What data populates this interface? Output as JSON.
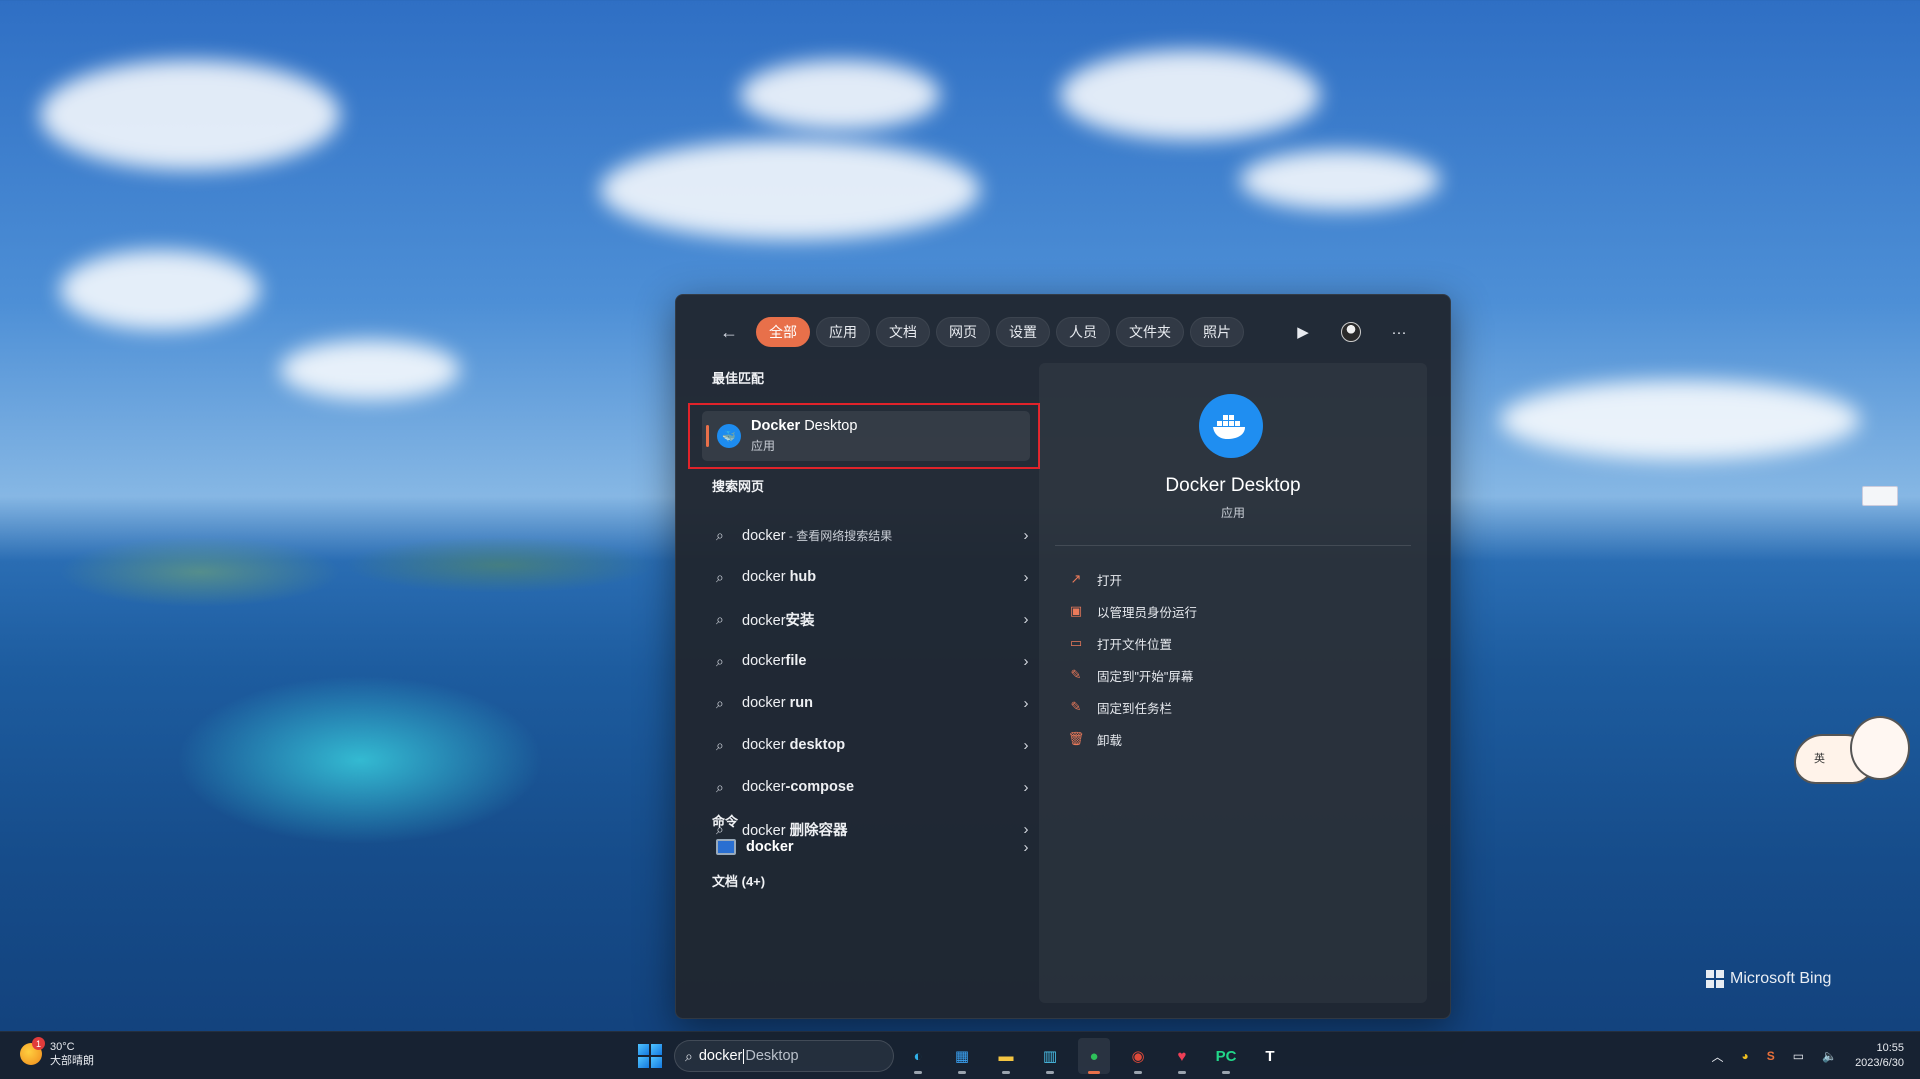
{
  "start_menu": {
    "filters": [
      "全部",
      "应用",
      "文档",
      "网页",
      "设置",
      "人员",
      "文件夹",
      "照片"
    ],
    "active_filter": "全部",
    "best_match_heading": "最佳匹配",
    "best_match": {
      "name_bold": "Docker",
      "name_rest": " Desktop",
      "type": "应用"
    },
    "web_search_heading": "搜索网页",
    "web_results": [
      {
        "pre": "docker",
        "bold": "",
        "hint": " - 查看网络搜索结果"
      },
      {
        "pre": "docker ",
        "bold": "hub",
        "hint": ""
      },
      {
        "pre": "docker",
        "bold": "安装",
        "hint": ""
      },
      {
        "pre": "docker",
        "bold": "file",
        "hint": ""
      },
      {
        "pre": "docker ",
        "bold": "run",
        "hint": ""
      },
      {
        "pre": "docker ",
        "bold": "desktop",
        "hint": ""
      },
      {
        "pre": "docker",
        "bold": "-compose",
        "hint": ""
      },
      {
        "pre": "docker ",
        "bold": "删除容器",
        "hint": ""
      }
    ],
    "commands_heading": "命令",
    "command": "docker",
    "documents_heading": "文档 (4+)",
    "preview": {
      "title": "Docker Desktop",
      "subtitle": "应用",
      "actions": [
        {
          "icon": "open-external-icon",
          "glyph": "↗",
          "label": "打开"
        },
        {
          "icon": "admin-shield-icon",
          "glyph": "▣",
          "label": "以管理员身份运行"
        },
        {
          "icon": "folder-icon",
          "glyph": "▭",
          "label": "打开文件位置"
        },
        {
          "icon": "pin-icon",
          "glyph": "✎",
          "label": "固定到\"开始\"屏幕"
        },
        {
          "icon": "pin-icon",
          "glyph": "✎",
          "label": "固定到任务栏"
        },
        {
          "icon": "trash-icon",
          "glyph": "🗑",
          "label": "卸载"
        }
      ]
    }
  },
  "taskbar": {
    "weather": {
      "temp": "30°C",
      "condition": "大部晴朗",
      "badge": "1"
    },
    "search": {
      "typed": "docker",
      "suggestion": "Desktop"
    },
    "apps": [
      {
        "name": "edge",
        "glyph": "◐",
        "color": "#2fb0e8",
        "active": false
      },
      {
        "name": "store",
        "glyph": "▦",
        "color": "#3aa0f0",
        "active": false
      },
      {
        "name": "file-explorer",
        "glyph": "▬",
        "color": "#f4c542",
        "active": false
      },
      {
        "name": "buildings",
        "glyph": "▥",
        "color": "#4ac0e8",
        "active": false
      },
      {
        "name": "wechat",
        "glyph": "●",
        "color": "#2ec15a",
        "active": true
      },
      {
        "name": "swirl",
        "glyph": "◉",
        "color": "#e04a3a",
        "active": false
      },
      {
        "name": "pocket",
        "glyph": "♥",
        "color": "#ef3f56",
        "active": false
      },
      {
        "name": "pycharm",
        "glyph": "PC",
        "color": "#21d789",
        "active": false
      },
      {
        "name": "typora",
        "glyph": "T",
        "color": "#ffffff",
        "active": false
      }
    ],
    "clock": {
      "time": "10:55",
      "date": "2023/6/30"
    }
  },
  "desktop": {
    "watermark": "Microsoft Bing",
    "mascot_label": "英"
  },
  "colors": {
    "accent": "#e8704a",
    "highlight_border": "#e0232a",
    "docker_blue": "#1d8cf0"
  }
}
